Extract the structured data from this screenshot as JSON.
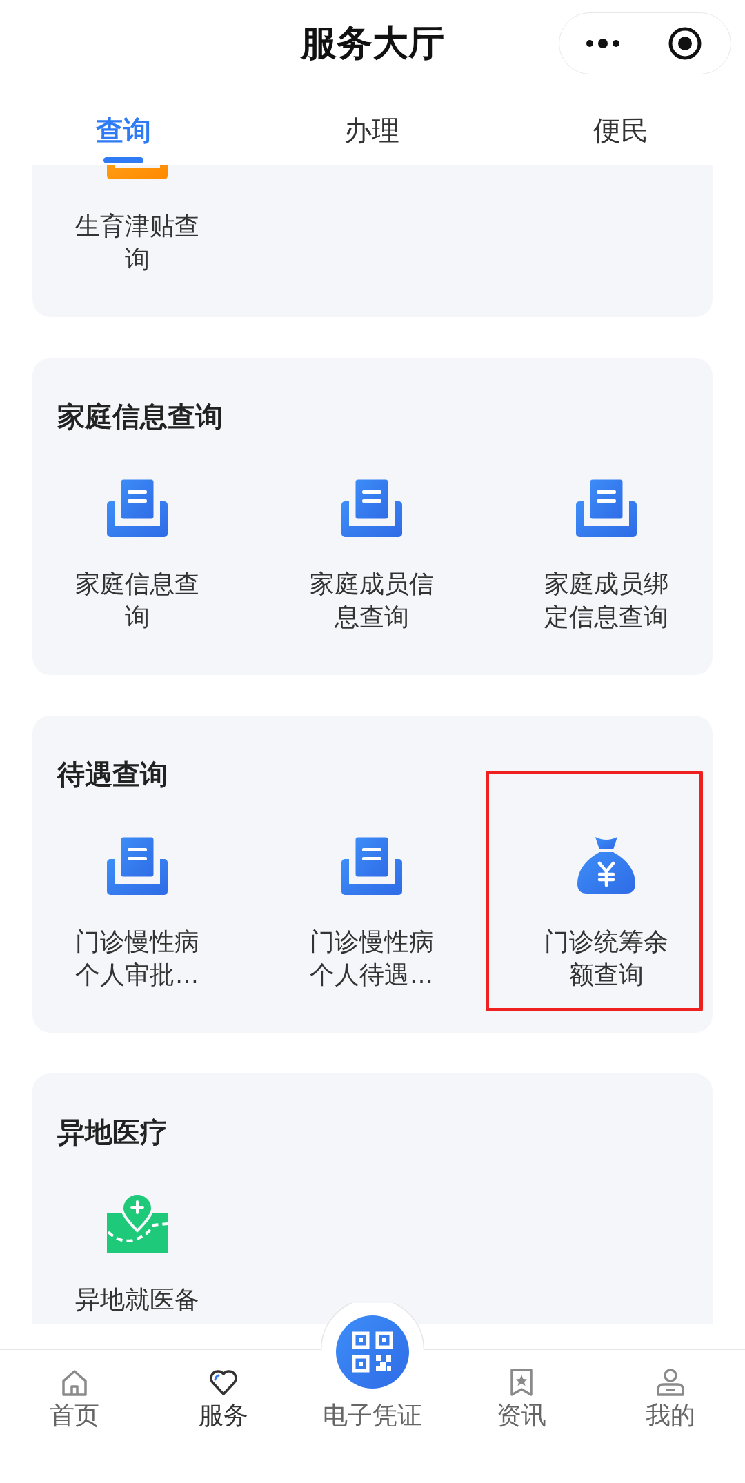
{
  "header": {
    "title": "服务大厅"
  },
  "tabs": [
    {
      "label": "查询",
      "selected": true
    },
    {
      "label": "办理",
      "selected": false
    },
    {
      "label": "便民",
      "selected": false
    }
  ],
  "sections": [
    {
      "items": [
        {
          "label": "生育津贴查询",
          "kind": "certificate",
          "highlighted": false
        }
      ]
    },
    {
      "title": "家庭信息查询",
      "items": [
        {
          "label": "家庭信息查询",
          "kind": "document",
          "highlighted": false
        },
        {
          "label": "家庭成员信息查询",
          "kind": "document",
          "highlighted": false
        },
        {
          "label": "家庭成员绑定信息查询",
          "kind": "document",
          "highlighted": false
        }
      ]
    },
    {
      "title": "待遇查询",
      "items": [
        {
          "label": "门诊慢性病个人审批…",
          "kind": "document",
          "highlighted": false
        },
        {
          "label": "门诊慢性病个人待遇…",
          "kind": "document",
          "highlighted": false
        },
        {
          "label": "门诊统筹余额查询",
          "kind": "money",
          "highlighted": true
        }
      ]
    },
    {
      "title": "异地医疗",
      "items": [
        {
          "label": "异地就医备",
          "kind": "map",
          "highlighted": false
        }
      ]
    }
  ],
  "bottom_nav": [
    {
      "label": "首页",
      "kind": "home",
      "selected": false
    },
    {
      "label": "服务",
      "kind": "heart",
      "selected": true
    },
    {
      "label": "电子凭证",
      "kind": "qr",
      "selected": false
    },
    {
      "label": "资讯",
      "kind": "bookmark",
      "selected": false
    },
    {
      "label": "我的",
      "kind": "person",
      "selected": false
    }
  ]
}
